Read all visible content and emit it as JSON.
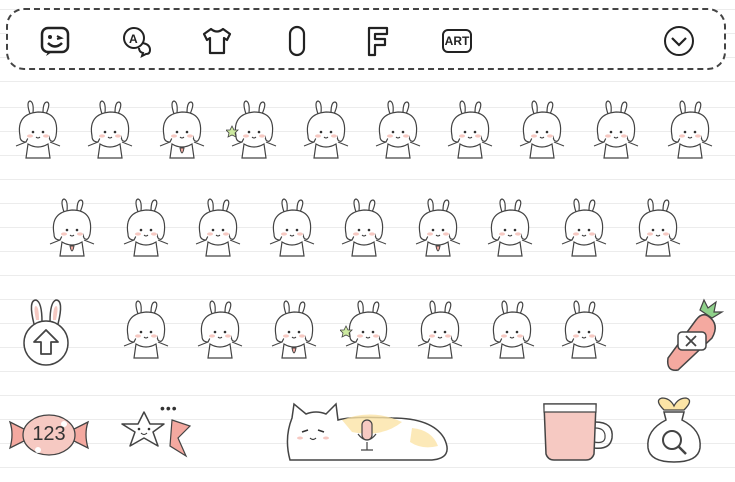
{
  "toolbar": {
    "items": [
      {
        "icon": "emoji-face-icon"
      },
      {
        "icon": "translate-icon"
      },
      {
        "icon": "tshirt-theme-icon"
      },
      {
        "icon": "microphone-icon"
      },
      {
        "icon": "font-icon"
      },
      {
        "icon": "art-icon",
        "label": "ART"
      },
      {
        "icon": "chevron-down-icon"
      }
    ]
  },
  "bottom_row": {
    "numbers_label": "123",
    "emoji_dots": "•••"
  },
  "colors": {
    "pink": "#f4a9a0",
    "peach": "#f6c9c2",
    "green": "#8fd18b",
    "yellow": "#fbe4a6",
    "outline": "#333333"
  }
}
